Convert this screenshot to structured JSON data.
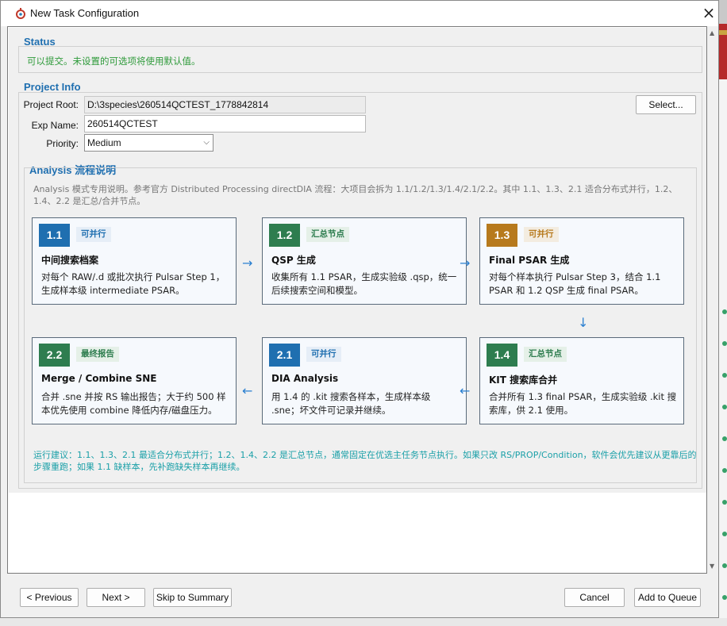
{
  "window": {
    "title": "New Task Configuration",
    "close_icon": "×"
  },
  "status": {
    "title": "Status",
    "message": "可以提交。未设置的可选项将使用默认值。"
  },
  "project_info": {
    "title": "Project Info",
    "root_label": "Project Root:",
    "root_value": "D:\\3species\\260514QCTEST_1778842814",
    "select_button": "Select...",
    "exp_label": "Exp Name:",
    "exp_value": "260514QCTEST",
    "priority_label": "Priority:",
    "priority_value": "Medium"
  },
  "analysis": {
    "title": "Analysis 流程说明",
    "description": "Analysis 模式专用说明。参考官方 Distributed Processing directDIA 流程：大项目会拆为 1.1/1.2/1.3/1.4/2.1/2.2。其中 1.1、1.3、2.1 适合分布式并行，1.2、1.4、2.2 是汇总/合并节点。",
    "steps": [
      {
        "num": "1.1",
        "tag": "可并行",
        "title": "中间搜索档案",
        "desc": "对每个 RAW/.d 或批次执行 Pulsar Step 1，生成样本级 intermediate PSAR。",
        "badge_color": "#1f6fb0",
        "tag_color": "#1f6fb0",
        "tag_bg": "#e6eef7"
      },
      {
        "num": "1.2",
        "tag": "汇总节点",
        "title": "QSP 生成",
        "desc": "收集所有 1.1 PSAR，生成实验级 .qsp，统一后续搜索空间和模型。",
        "badge_color": "#2e7d4f",
        "tag_color": "#2e7d4f",
        "tag_bg": "#e5f0e8"
      },
      {
        "num": "1.3",
        "tag": "可并行",
        "title": "Final PSAR 生成",
        "desc": "对每个样本执行 Pulsar Step 3，结合 1.1 PSAR 和 1.2 QSP 生成 final PSAR。",
        "badge_color": "#b77a1d",
        "tag_color": "#b77a1d",
        "tag_bg": "#f3ece0"
      },
      {
        "num": "1.4",
        "tag": "汇总节点",
        "title": "KIT 搜索库合并",
        "desc": "合并所有 1.3 final PSAR，生成实验级 .kit 搜索库，供 2.1 使用。",
        "badge_color": "#2e7d4f",
        "tag_color": "#2e7d4f",
        "tag_bg": "#e5f0e8"
      },
      {
        "num": "2.1",
        "tag": "可并行",
        "title": "DIA Analysis",
        "desc": "用 1.4 的 .kit 搜索各样本，生成样本级 .sne；坏文件可记录并继续。",
        "badge_color": "#1f6fb0",
        "tag_color": "#1f6fb0",
        "tag_bg": "#e6eef7"
      },
      {
        "num": "2.2",
        "tag": "最终报告",
        "title": "Merge / Combine SNE",
        "desc": "合并 .sne 并按 RS 输出报告；大于约 500 样本优先使用 combine 降低内存/磁盘压力。",
        "badge_color": "#2e7d4f",
        "tag_color": "#2e7d4f",
        "tag_bg": "#e5f0e8"
      }
    ],
    "arrow_right": "→",
    "arrow_down": "↓",
    "arrow_left": "←",
    "tip": "运行建议：1.1、1.3、2.1 最适合分布式并行；1.2、1.4、2.2 是汇总节点，通常固定在优选主任务节点执行。如果只改 RS/PROP/Condition，软件会优先建议从更靠后的步骤重跑；如果 1.1 缺样本，先补跑缺失样本再继续。"
  },
  "footer": {
    "previous": "< Previous",
    "next": "Next >",
    "skip": "Skip to Summary",
    "cancel": "Cancel",
    "add": "Add to Queue"
  }
}
